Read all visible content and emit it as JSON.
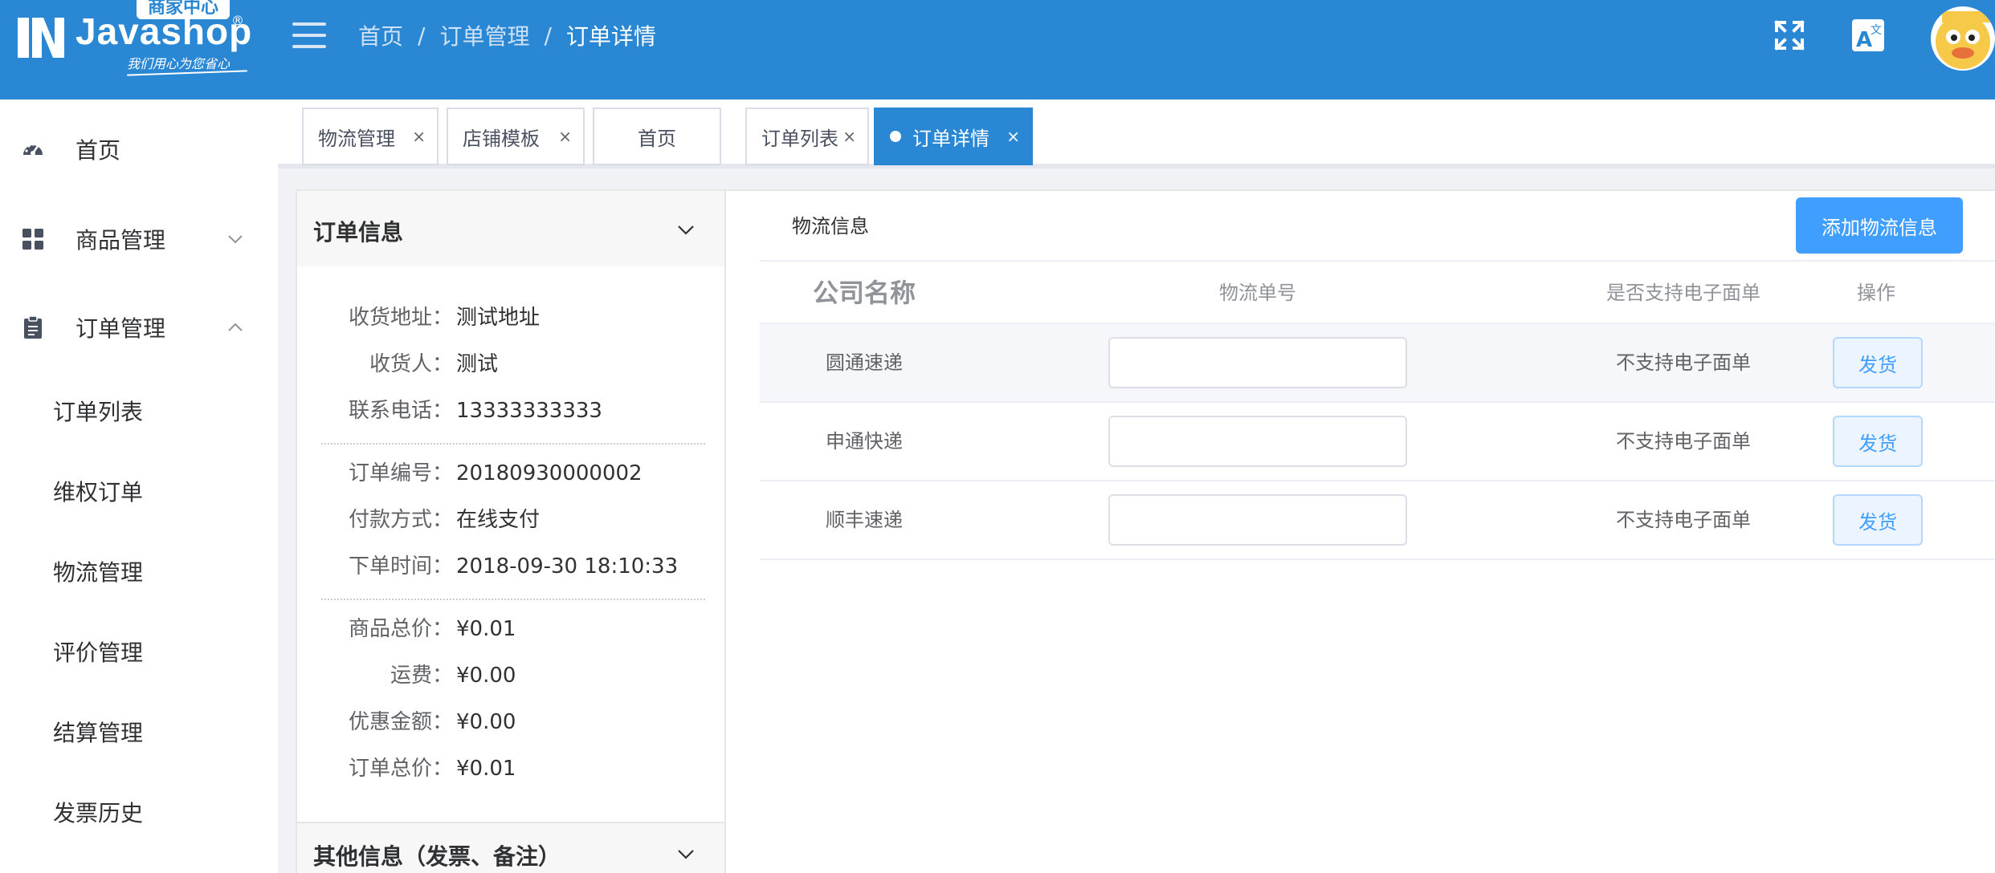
{
  "header": {
    "logo_badge": "商家中心",
    "logo_word": "Javashop",
    "logo_reg": "®",
    "logo_slogan": "我们用心为您省心",
    "breadcrumb": [
      "首页",
      "订单管理",
      "订单详情"
    ],
    "breadcrumb_sep": "/",
    "brand_color": "#2a87d4"
  },
  "sidebar": {
    "items": [
      {
        "label": "首页",
        "icon": "dashboard-icon"
      },
      {
        "label": "商品管理",
        "icon": "grid-icon",
        "arrow": "chevron-down-icon"
      },
      {
        "label": "订单管理",
        "icon": "clipboard-icon",
        "arrow": "chevron-up-icon"
      }
    ],
    "sub_items": [
      "订单列表",
      "维权订单",
      "物流管理",
      "评价管理",
      "结算管理",
      "发票历史"
    ]
  },
  "tabs": [
    {
      "label": "物流管理",
      "close": "×"
    },
    {
      "label": "店铺模板",
      "close": "×"
    },
    {
      "label": "首页",
      "close": ""
    },
    {
      "label": "订单列表",
      "close": "×"
    },
    {
      "label": "订单详情",
      "close": "×",
      "active": true
    }
  ],
  "order_panel": {
    "title": "订单信息",
    "group1": [
      {
        "k": "收货地址：",
        "v": "测试地址"
      },
      {
        "k": "收货人：",
        "v": "测试"
      },
      {
        "k": "联系电话：",
        "v": "13333333333"
      }
    ],
    "group2": [
      {
        "k": "订单编号：",
        "v": "20180930000002"
      },
      {
        "k": "付款方式：",
        "v": "在线支付"
      },
      {
        "k": "下单时间：",
        "v": "2018-09-30 18:10:33"
      }
    ],
    "group3": [
      {
        "k": "商品总价：",
        "v": "¥0.01"
      },
      {
        "k": "运费：",
        "v": "¥0.00"
      },
      {
        "k": "优惠金额：",
        "v": "¥0.00"
      },
      {
        "k": "订单总价：",
        "v": "¥0.01"
      }
    ],
    "other_title": "其他信息（发票、备注）"
  },
  "logistics": {
    "title": "物流信息",
    "add_button": "添加物流信息",
    "columns": [
      "公司名称",
      "物流单号",
      "是否支持电子面单",
      "操作"
    ],
    "rows": [
      {
        "company": "圆通速递",
        "tracking": "",
        "e_sheet": "不支持电子面单",
        "action": "发货"
      },
      {
        "company": "申通快递",
        "tracking": "",
        "e_sheet": "不支持电子面单",
        "action": "发货"
      },
      {
        "company": "顺丰速递",
        "tracking": "",
        "e_sheet": "不支持电子面单",
        "action": "发货"
      }
    ]
  }
}
